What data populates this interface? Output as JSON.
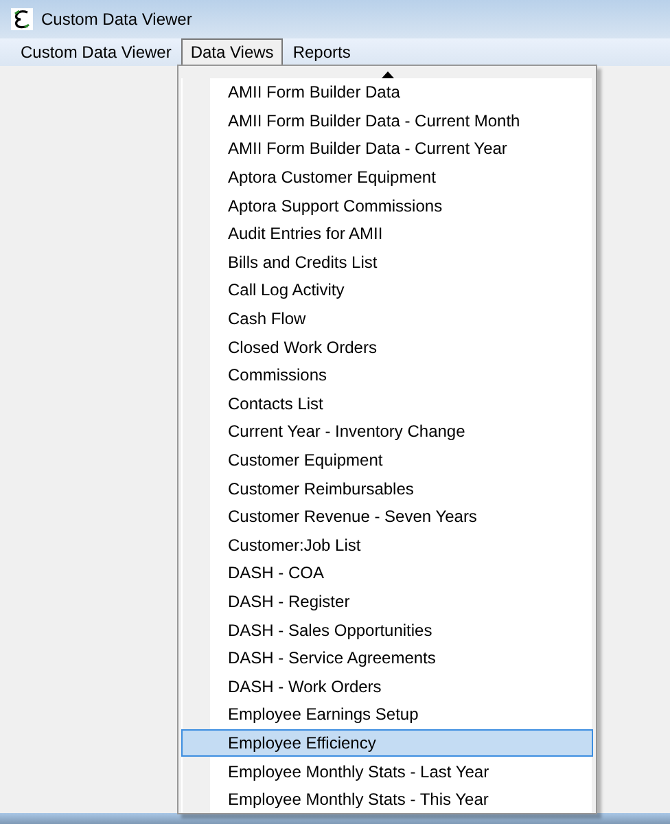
{
  "window": {
    "title": "Custom Data Viewer"
  },
  "menubar": [
    {
      "label": "Custom Data Viewer",
      "selected": false
    },
    {
      "label": "Data Views",
      "selected": true
    },
    {
      "label": "Reports",
      "selected": false
    }
  ],
  "dropdown": {
    "items": [
      {
        "label": "AMII Form Builder Data",
        "selected": false
      },
      {
        "label": "AMII Form Builder Data - Current Month",
        "selected": false
      },
      {
        "label": "AMII Form Builder Data - Current Year",
        "selected": false
      },
      {
        "label": "Aptora Customer Equipment",
        "selected": false
      },
      {
        "label": "Aptora Support Commissions",
        "selected": false
      },
      {
        "label": "Audit Entries for AMII",
        "selected": false
      },
      {
        "label": "Bills and Credits List",
        "selected": false
      },
      {
        "label": "Call Log Activity",
        "selected": false
      },
      {
        "label": "Cash Flow",
        "selected": false
      },
      {
        "label": "Closed Work Orders",
        "selected": false
      },
      {
        "label": "Commissions",
        "selected": false
      },
      {
        "label": "Contacts List",
        "selected": false
      },
      {
        "label": "Current Year - Inventory Change",
        "selected": false
      },
      {
        "label": "Customer Equipment",
        "selected": false
      },
      {
        "label": "Customer Reimbursables",
        "selected": false
      },
      {
        "label": "Customer Revenue - Seven Years",
        "selected": false
      },
      {
        "label": "Customer:Job List",
        "selected": false
      },
      {
        "label": "DASH - COA",
        "selected": false
      },
      {
        "label": "DASH - Register",
        "selected": false
      },
      {
        "label": "DASH - Sales Opportunities",
        "selected": false
      },
      {
        "label": "DASH - Service Agreements",
        "selected": false
      },
      {
        "label": "DASH - Work Orders",
        "selected": false
      },
      {
        "label": "Employee Earnings Setup",
        "selected": false
      },
      {
        "label": "Employee Efficiency",
        "selected": true
      },
      {
        "label": "Employee Monthly Stats - Last Year",
        "selected": false
      },
      {
        "label": "Employee Monthly Stats - This Year",
        "selected": false
      }
    ]
  }
}
